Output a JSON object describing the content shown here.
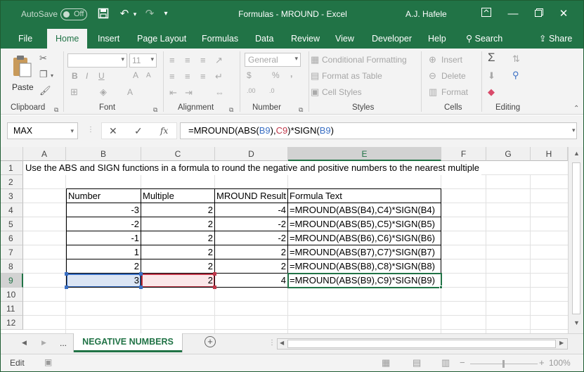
{
  "titlebar": {
    "autosave_label": "AutoSave",
    "autosave_state": "Off",
    "title": "Formulas - MROUND  -  Excel",
    "user": "A.J. Hafele"
  },
  "ribbon_tabs": [
    "File",
    "Home",
    "Insert",
    "Page Layout",
    "Formulas",
    "Data",
    "Review",
    "View",
    "Developer",
    "Help",
    "Search",
    "Share"
  ],
  "ribbon": {
    "clipboard": {
      "paste": "Paste",
      "label": "Clipboard"
    },
    "font": {
      "font_name": "",
      "font_size": "11",
      "label": "Font"
    },
    "alignment": {
      "label": "Alignment"
    },
    "number": {
      "format": "General",
      "label": "Number"
    },
    "styles": {
      "conditional": "Conditional Formatting",
      "format_table": "Format as Table",
      "cell_styles": "Cell Styles",
      "label": "Styles"
    },
    "cells": {
      "insert": "Insert",
      "delete": "Delete",
      "format": "Format",
      "label": "Cells"
    },
    "editing": {
      "label": "Editing"
    }
  },
  "formula_bar": {
    "name_box": "MAX",
    "formula_prefix": "=MROUND(ABS(",
    "ref1": "B9",
    "mid1": "),",
    "ref2": "C9",
    "mid2": ")*SIGN(",
    "ref3": "B9",
    "suffix": ")"
  },
  "columns": [
    "A",
    "B",
    "C",
    "D",
    "E",
    "F",
    "G",
    "H"
  ],
  "rows": [
    "1",
    "2",
    "3",
    "4",
    "5",
    "6",
    "7",
    "8",
    "9",
    "10",
    "11",
    "12"
  ],
  "sheet": {
    "a1": "Use the ABS and SIGN functions in a formula to round the negative and positive numbers to the nearest multiple",
    "headers": [
      "Number",
      "Multiple",
      "MROUND Result",
      "Formula Text"
    ],
    "data": [
      {
        "number": "-3",
        "multiple": "2",
        "result": "-4",
        "formula": "=MROUND(ABS(B4),C4)*SIGN(B4)"
      },
      {
        "number": "-2",
        "multiple": "2",
        "result": "-2",
        "formula": "=MROUND(ABS(B5),C5)*SIGN(B5)"
      },
      {
        "number": "-1",
        "multiple": "2",
        "result": "-2",
        "formula": "=MROUND(ABS(B6),C6)*SIGN(B6)"
      },
      {
        "number": "1",
        "multiple": "2",
        "result": "2",
        "formula": "=MROUND(ABS(B7),C7)*SIGN(B7)"
      },
      {
        "number": "2",
        "multiple": "2",
        "result": "2",
        "formula": "=MROUND(ABS(B8),C8)*SIGN(B8)"
      },
      {
        "number": "3",
        "multiple": "2",
        "result": "4",
        "formula": "=MROUND(ABS(B9),C9)*SIGN(B9)"
      }
    ]
  },
  "sheet_tabs": {
    "ellipsis": "...",
    "active": "NEGATIVE NUMBERS"
  },
  "status": {
    "mode": "Edit",
    "zoom": "100%"
  },
  "colors": {
    "excel_green": "#217346",
    "ref_blue": "#3a6fc4",
    "ref_red": "#c0384a"
  }
}
